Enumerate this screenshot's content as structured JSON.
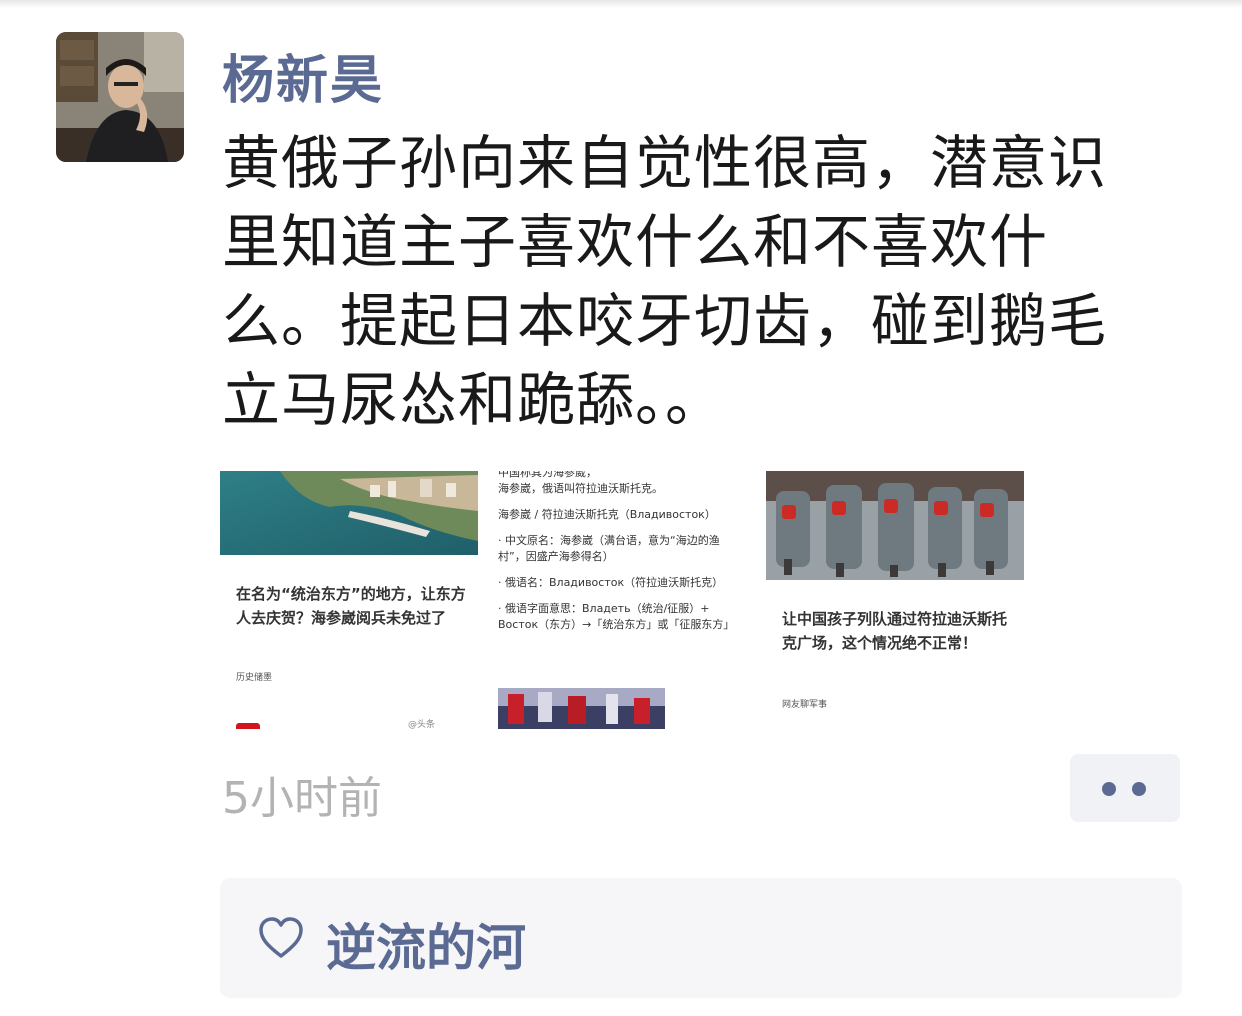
{
  "post": {
    "author": "杨新昊",
    "text": "黄俄子孙向来自觉性很高，潜意识里知道主子喜欢什么和不喜欢什么。提起日本咬牙切齿，碰到鹅毛立马尿怂和跪舔。。",
    "timestamp": "5小时前"
  },
  "images": {
    "first": {
      "headline": "在名为“统治东方”的地方，让东方人去庆贺？海参崴阅兵未免过了",
      "source": "历史储墨",
      "mark": "@头条"
    },
    "second": {
      "lines": [
        "中国称其为海参崴，",
        "海参崴，俄语叫符拉迪沃斯托克。",
        "",
        "海参崴 / 符拉迪沃斯托克（Владивосток）",
        "",
        "· 中文原名：海参崴（满台语，意为“海边的渔村”，因盛产海参得名）",
        "",
        "· 俄语名：Владивосток（符拉迪沃斯托克）",
        "",
        "· 俄语字面意思：Владеть（统治/征服）+ Восток（东方）→「统治东方」或「征服东方」"
      ]
    },
    "third": {
      "headline": "让中国孩子列队通过符拉迪沃斯托克广场，这个情况绝不正常！",
      "source": "网友聊军事"
    }
  },
  "likes": {
    "names": "逆流的河"
  },
  "colors": {
    "name_blue": "#5b6a92",
    "text": "#191919",
    "timestamp_gray": "#b3b3b3",
    "like_box_bg": "#f6f6f8"
  },
  "icons": {
    "more": "more-dots-icon",
    "like": "heart-outline-icon"
  }
}
